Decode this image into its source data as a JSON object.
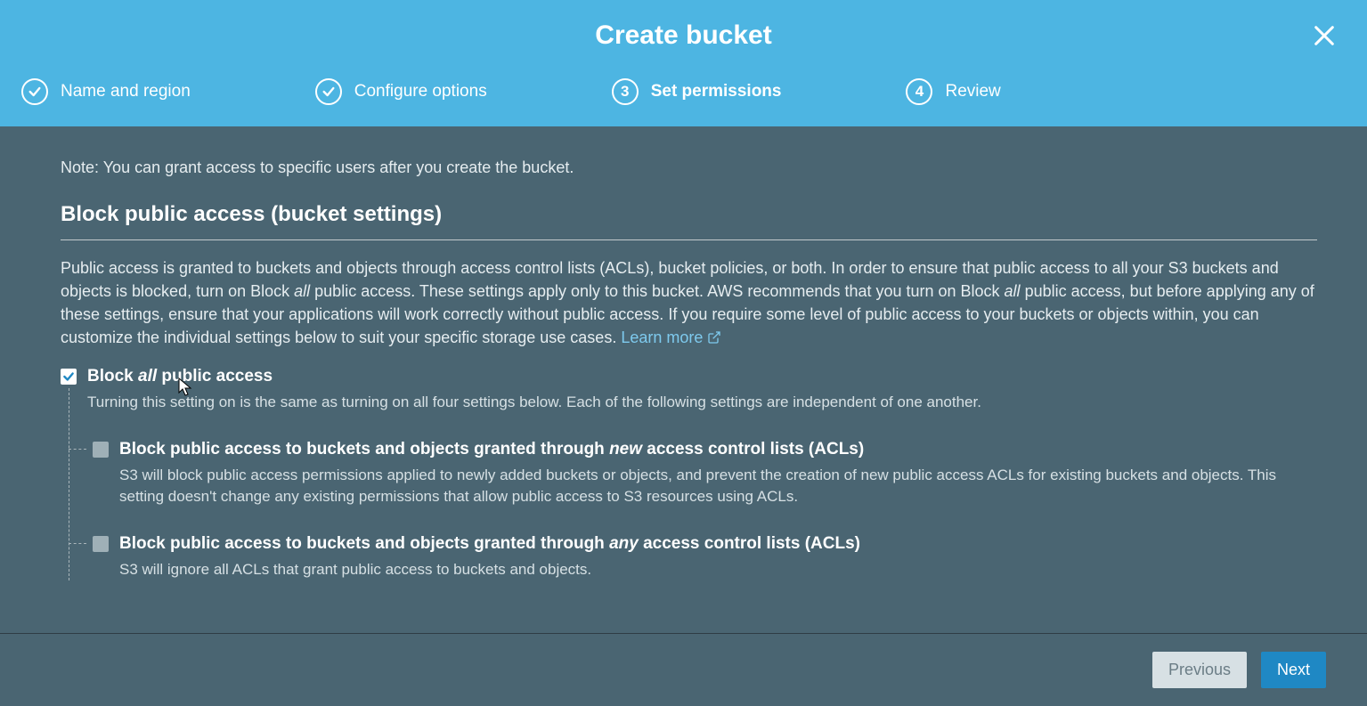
{
  "modal": {
    "title": "Create bucket"
  },
  "steps": [
    {
      "label": "Name and region",
      "state": "done"
    },
    {
      "label": "Configure options",
      "state": "done"
    },
    {
      "label": "Set permissions",
      "state": "active",
      "number": "3"
    },
    {
      "label": "Review",
      "state": "pending",
      "number": "4"
    }
  ],
  "note": "Note: You can grant access to specific users after you create the bucket.",
  "section_title": "Block public access (bucket settings)",
  "desc_part1": "Public access is granted to buckets and objects through access control lists (ACLs), bucket policies, or both. In order to ensure that public access to all your S3 buckets and objects is blocked, turn on Block ",
  "desc_em1": "all",
  "desc_part2": " public access. These settings apply only to this bucket. AWS recommends that you turn on Block ",
  "desc_em2": "all",
  "desc_part3": " public access, but before applying any of these settings, ensure that your applications will work correctly without public access. If you require some level of public access to your buckets or objects within, you can customize the individual settings below to suit your specific storage use cases. ",
  "learn_more": "Learn more",
  "block_all": {
    "title_before": "Block ",
    "title_em": "all",
    "title_after": " public access",
    "checked": true,
    "desc": "Turning this setting on is the same as turning on all four settings below. Each of the following settings are independent of one another."
  },
  "sub": [
    {
      "title_before": "Block public access to buckets and objects granted through ",
      "title_em": "new",
      "title_after": " access control lists (ACLs)",
      "desc": "S3 will block public access permissions applied to newly added buckets or objects, and prevent the creation of new public access ACLs for existing buckets and objects. This setting doesn't change any existing permissions that allow public access to S3 resources using ACLs."
    },
    {
      "title_before": "Block public access to buckets and objects granted through ",
      "title_em": "any",
      "title_after": " access control lists (ACLs)",
      "desc": "S3 will ignore all ACLs that grant public access to buckets and objects."
    }
  ],
  "buttons": {
    "previous": "Previous",
    "next": "Next"
  }
}
